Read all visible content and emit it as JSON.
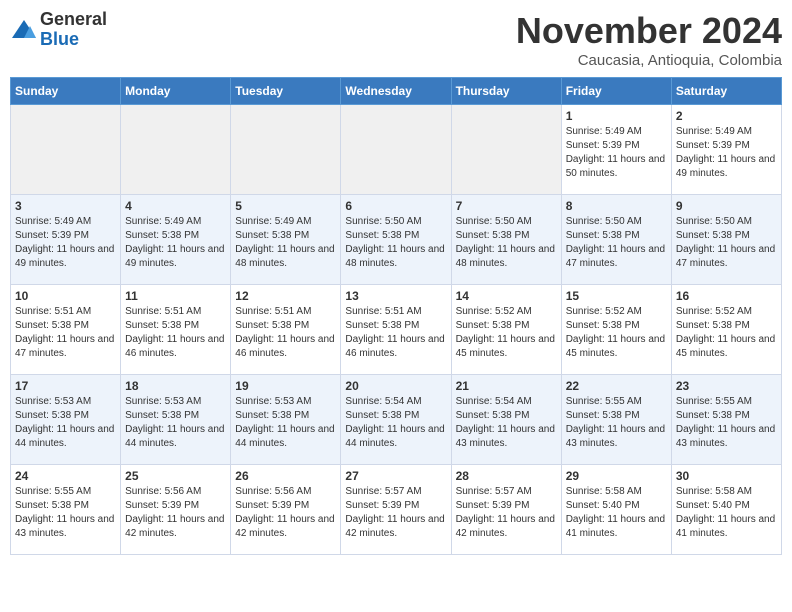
{
  "logo": {
    "general": "General",
    "blue": "Blue"
  },
  "title": "November 2024",
  "subtitle": "Caucasia, Antioquia, Colombia",
  "headers": [
    "Sunday",
    "Monday",
    "Tuesday",
    "Wednesday",
    "Thursday",
    "Friday",
    "Saturday"
  ],
  "weeks": [
    [
      {
        "day": "",
        "info": ""
      },
      {
        "day": "",
        "info": ""
      },
      {
        "day": "",
        "info": ""
      },
      {
        "day": "",
        "info": ""
      },
      {
        "day": "",
        "info": ""
      },
      {
        "day": "1",
        "info": "Sunrise: 5:49 AM\nSunset: 5:39 PM\nDaylight: 11 hours and 50 minutes."
      },
      {
        "day": "2",
        "info": "Sunrise: 5:49 AM\nSunset: 5:39 PM\nDaylight: 11 hours and 49 minutes."
      }
    ],
    [
      {
        "day": "3",
        "info": "Sunrise: 5:49 AM\nSunset: 5:39 PM\nDaylight: 11 hours and 49 minutes."
      },
      {
        "day": "4",
        "info": "Sunrise: 5:49 AM\nSunset: 5:38 PM\nDaylight: 11 hours and 49 minutes."
      },
      {
        "day": "5",
        "info": "Sunrise: 5:49 AM\nSunset: 5:38 PM\nDaylight: 11 hours and 48 minutes."
      },
      {
        "day": "6",
        "info": "Sunrise: 5:50 AM\nSunset: 5:38 PM\nDaylight: 11 hours and 48 minutes."
      },
      {
        "day": "7",
        "info": "Sunrise: 5:50 AM\nSunset: 5:38 PM\nDaylight: 11 hours and 48 minutes."
      },
      {
        "day": "8",
        "info": "Sunrise: 5:50 AM\nSunset: 5:38 PM\nDaylight: 11 hours and 47 minutes."
      },
      {
        "day": "9",
        "info": "Sunrise: 5:50 AM\nSunset: 5:38 PM\nDaylight: 11 hours and 47 minutes."
      }
    ],
    [
      {
        "day": "10",
        "info": "Sunrise: 5:51 AM\nSunset: 5:38 PM\nDaylight: 11 hours and 47 minutes."
      },
      {
        "day": "11",
        "info": "Sunrise: 5:51 AM\nSunset: 5:38 PM\nDaylight: 11 hours and 46 minutes."
      },
      {
        "day": "12",
        "info": "Sunrise: 5:51 AM\nSunset: 5:38 PM\nDaylight: 11 hours and 46 minutes."
      },
      {
        "day": "13",
        "info": "Sunrise: 5:51 AM\nSunset: 5:38 PM\nDaylight: 11 hours and 46 minutes."
      },
      {
        "day": "14",
        "info": "Sunrise: 5:52 AM\nSunset: 5:38 PM\nDaylight: 11 hours and 45 minutes."
      },
      {
        "day": "15",
        "info": "Sunrise: 5:52 AM\nSunset: 5:38 PM\nDaylight: 11 hours and 45 minutes."
      },
      {
        "day": "16",
        "info": "Sunrise: 5:52 AM\nSunset: 5:38 PM\nDaylight: 11 hours and 45 minutes."
      }
    ],
    [
      {
        "day": "17",
        "info": "Sunrise: 5:53 AM\nSunset: 5:38 PM\nDaylight: 11 hours and 44 minutes."
      },
      {
        "day": "18",
        "info": "Sunrise: 5:53 AM\nSunset: 5:38 PM\nDaylight: 11 hours and 44 minutes."
      },
      {
        "day": "19",
        "info": "Sunrise: 5:53 AM\nSunset: 5:38 PM\nDaylight: 11 hours and 44 minutes."
      },
      {
        "day": "20",
        "info": "Sunrise: 5:54 AM\nSunset: 5:38 PM\nDaylight: 11 hours and 44 minutes."
      },
      {
        "day": "21",
        "info": "Sunrise: 5:54 AM\nSunset: 5:38 PM\nDaylight: 11 hours and 43 minutes."
      },
      {
        "day": "22",
        "info": "Sunrise: 5:55 AM\nSunset: 5:38 PM\nDaylight: 11 hours and 43 minutes."
      },
      {
        "day": "23",
        "info": "Sunrise: 5:55 AM\nSunset: 5:38 PM\nDaylight: 11 hours and 43 minutes."
      }
    ],
    [
      {
        "day": "24",
        "info": "Sunrise: 5:55 AM\nSunset: 5:38 PM\nDaylight: 11 hours and 43 minutes."
      },
      {
        "day": "25",
        "info": "Sunrise: 5:56 AM\nSunset: 5:39 PM\nDaylight: 11 hours and 42 minutes."
      },
      {
        "day": "26",
        "info": "Sunrise: 5:56 AM\nSunset: 5:39 PM\nDaylight: 11 hours and 42 minutes."
      },
      {
        "day": "27",
        "info": "Sunrise: 5:57 AM\nSunset: 5:39 PM\nDaylight: 11 hours and 42 minutes."
      },
      {
        "day": "28",
        "info": "Sunrise: 5:57 AM\nSunset: 5:39 PM\nDaylight: 11 hours and 42 minutes."
      },
      {
        "day": "29",
        "info": "Sunrise: 5:58 AM\nSunset: 5:40 PM\nDaylight: 11 hours and 41 minutes."
      },
      {
        "day": "30",
        "info": "Sunrise: 5:58 AM\nSunset: 5:40 PM\nDaylight: 11 hours and 41 minutes."
      }
    ]
  ]
}
